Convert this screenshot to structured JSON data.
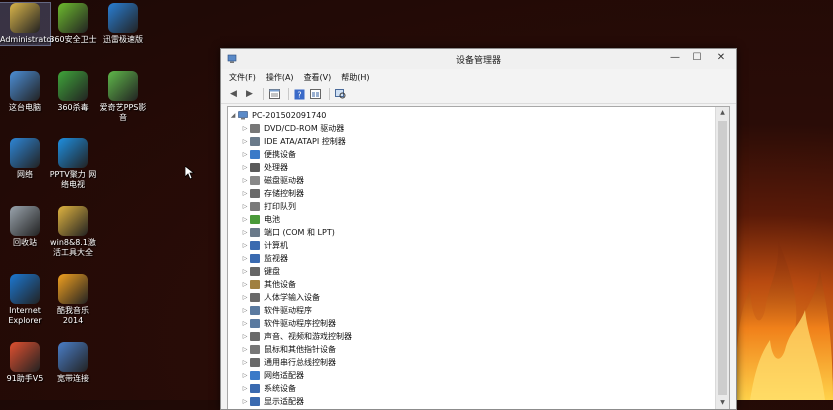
{
  "desktop": {
    "icons": [
      {
        "label": "Administrator",
        "icon": "user-folder-icon",
        "color": "#d9b54a"
      },
      {
        "label": "360安全卫士",
        "icon": "360-security-icon",
        "color": "#6dbb2e"
      },
      {
        "label": "迅雷极速版",
        "icon": "xunlei-bird-icon",
        "color": "#2a7fd4"
      },
      {
        "label": "这台电脑",
        "icon": "computer-icon",
        "color": "#4c8ed6"
      },
      {
        "label": "360杀毒",
        "icon": "360-antivirus-icon",
        "color": "#3fa53a"
      },
      {
        "label": "爱奇艺PPS影音",
        "icon": "pps-player-icon",
        "color": "#5fb84a"
      },
      {
        "label": "网络",
        "icon": "network-globe-icon",
        "color": "#2e86d6"
      },
      {
        "label": "PPTV聚力 网络电视",
        "icon": "pptv-icon",
        "color": "#1e8fe0"
      },
      {
        "label": "回收站",
        "icon": "recycle-bin-icon",
        "color": "#9aa4ad"
      },
      {
        "label": "win8&8.1激活工具大全",
        "icon": "folder-zip-icon",
        "color": "#e0b440"
      },
      {
        "label": "Internet Explorer",
        "icon": "ie-icon",
        "color": "#1c78d2"
      },
      {
        "label": "酷我音乐2014",
        "icon": "kuwo-music-icon",
        "color": "#f0a020"
      },
      {
        "label": "91助手V5",
        "icon": "91-assistant-icon",
        "color": "#e05030"
      },
      {
        "label": "宽带连接",
        "icon": "broadband-icon",
        "color": "#4a7ec8"
      }
    ]
  },
  "window": {
    "title": "设备管理器",
    "controls": {
      "minimize": "—",
      "maximize": "☐",
      "close": "✕"
    },
    "menu": [
      "文件(F)",
      "操作(A)",
      "查看(V)",
      "帮助(H)"
    ],
    "root": "PC-201502091740",
    "devices": [
      {
        "label": "DVD/CD-ROM 驱动器",
        "icon": "dvd-drive-icon",
        "color": "#777"
      },
      {
        "label": "IDE ATA/ATAPI 控制器",
        "icon": "ide-controller-icon",
        "color": "#6a7a8a"
      },
      {
        "label": "便携设备",
        "icon": "portable-device-icon",
        "color": "#3a7ac8"
      },
      {
        "label": "处理器",
        "icon": "processor-icon",
        "color": "#5a5a5a"
      },
      {
        "label": "磁盘驱动器",
        "icon": "disk-drive-icon",
        "color": "#888"
      },
      {
        "label": "存储控制器",
        "icon": "storage-controller-icon",
        "color": "#6a6a6a"
      },
      {
        "label": "打印队列",
        "icon": "printer-icon",
        "color": "#7a7a7a"
      },
      {
        "label": "电池",
        "icon": "battery-icon",
        "color": "#4a9a3a"
      },
      {
        "label": "端口 (COM 和 LPT)",
        "icon": "port-icon",
        "color": "#6a7a8a"
      },
      {
        "label": "计算机",
        "icon": "computer-icon",
        "color": "#3a6ab0"
      },
      {
        "label": "监视器",
        "icon": "monitor-icon",
        "color": "#3a6ab0"
      },
      {
        "label": "键盘",
        "icon": "keyboard-icon",
        "color": "#666"
      },
      {
        "label": "其他设备",
        "icon": "other-device-icon",
        "color": "#a08040"
      },
      {
        "label": "人体学输入设备",
        "icon": "hid-icon",
        "color": "#6a6a6a"
      },
      {
        "label": "软件驱动程序",
        "icon": "software-driver-icon",
        "color": "#5a7aa0"
      },
      {
        "label": "软件驱动程序控制器",
        "icon": "driver-controller-icon",
        "color": "#5a7aa0"
      },
      {
        "label": "声音、视频和游戏控制器",
        "icon": "sound-icon",
        "color": "#6a6a6a"
      },
      {
        "label": "鼠标和其他指针设备",
        "icon": "mouse-icon",
        "color": "#777"
      },
      {
        "label": "通用串行总线控制器",
        "icon": "usb-icon",
        "color": "#6a6a6a"
      },
      {
        "label": "网络适配器",
        "icon": "network-adapter-icon",
        "color": "#3a7ac8"
      },
      {
        "label": "系统设备",
        "icon": "system-device-icon",
        "color": "#3a6ab0"
      },
      {
        "label": "显示适配器",
        "icon": "display-adapter-icon",
        "color": "#3a6ab0"
      }
    ]
  }
}
